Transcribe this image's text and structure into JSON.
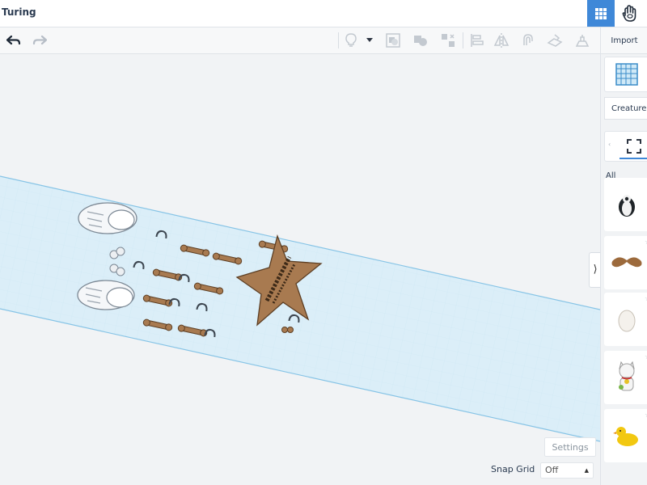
{
  "app": {
    "title": "Turing"
  },
  "header": {
    "view_buttons": [
      {
        "name": "3d-design-grid-icon",
        "active": true
      },
      {
        "name": "codeblocks-hand-icon",
        "active": false
      }
    ]
  },
  "toolbar": {
    "tools": [
      "undo-icon",
      "redo-icon",
      "light-bulb-icon",
      "dropdown-caret-icon",
      "group-icon",
      "ungroup-icon",
      "align-tool-icon",
      "align-icon",
      "mirror-icon",
      "cruise-icon",
      "workplane-icon",
      "ruler-icon"
    ],
    "import_label": "Import"
  },
  "panel": {
    "library": "Creatures",
    "filter_label": "All",
    "shapes": [
      "penguin",
      "mustache",
      "egg",
      "lucky-cat",
      "duck"
    ]
  },
  "footer": {
    "settings_label": "Settings",
    "snap_grid_label": "Snap Grid",
    "snap_grid_value": "Off"
  },
  "colors": {
    "accent": "#3f88d8",
    "workplane": "#dbeef8",
    "part": "#a87a50",
    "part_edge": "#5d3f24"
  }
}
